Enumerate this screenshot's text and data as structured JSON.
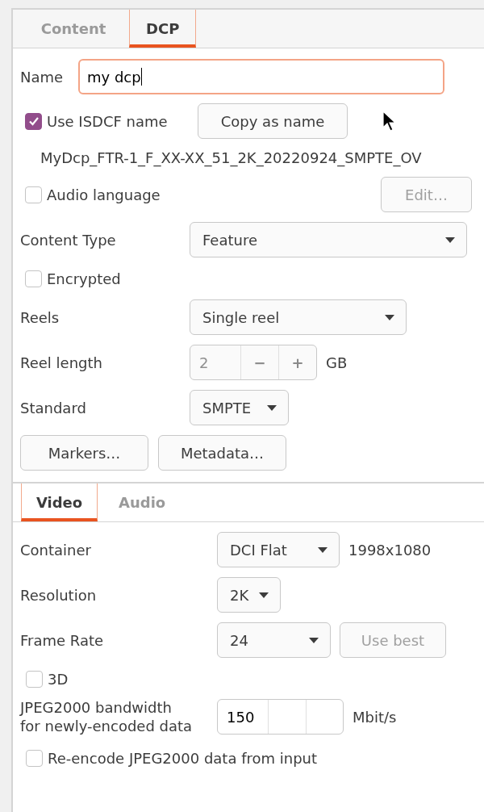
{
  "tabs": [
    {
      "label": "Content",
      "selected": false
    },
    {
      "label": "DCP",
      "selected": true
    }
  ],
  "name": {
    "label": "Name",
    "value": "my dcp",
    "focused": true
  },
  "use_isdcf": {
    "label": "Use ISDCF name",
    "checked": true
  },
  "copy_button": {
    "label": "Copy as name"
  },
  "isdcf_name": "MyDcp_FTR-1_F_XX-XX_51_2K_20220924_SMPTE_OV",
  "audio_language": {
    "label": "Audio language",
    "checked": false
  },
  "edit_button": {
    "label": "Edit…",
    "disabled": true
  },
  "content_type": {
    "label": "Content Type",
    "value": "Feature"
  },
  "encrypted": {
    "label": "Encrypted",
    "checked": false
  },
  "reels": {
    "label": "Reels",
    "value": "Single reel"
  },
  "reel_length": {
    "label": "Reel length",
    "value": "2",
    "minus": "−",
    "plus": "+",
    "unit": "GB",
    "disabled": true
  },
  "standard": {
    "label": "Standard",
    "value": "SMPTE"
  },
  "buttons": [
    "Markers…",
    "Metadata…"
  ],
  "sub_tabs": [
    {
      "label": "Video",
      "selected": true
    },
    {
      "label": "Audio",
      "selected": false
    }
  ],
  "container": {
    "label": "Container",
    "value": "DCI Flat",
    "info": "1998x1080"
  },
  "resolution": {
    "label": "Resolution",
    "value": "2K"
  },
  "frame_rate": {
    "label": "Frame Rate",
    "value": "24"
  },
  "use_best": {
    "label": "Use best",
    "disabled": true
  },
  "three_d": {
    "label": "3D",
    "checked": false
  },
  "bandwidth": {
    "label_lines": [
      "JPEG2000 bandwidth",
      "for newly-encoded data"
    ],
    "value": "150",
    "unit": "Mbit/s"
  },
  "reencode": {
    "label": "Re-encode JPEG2000 data from input",
    "checked": false
  }
}
